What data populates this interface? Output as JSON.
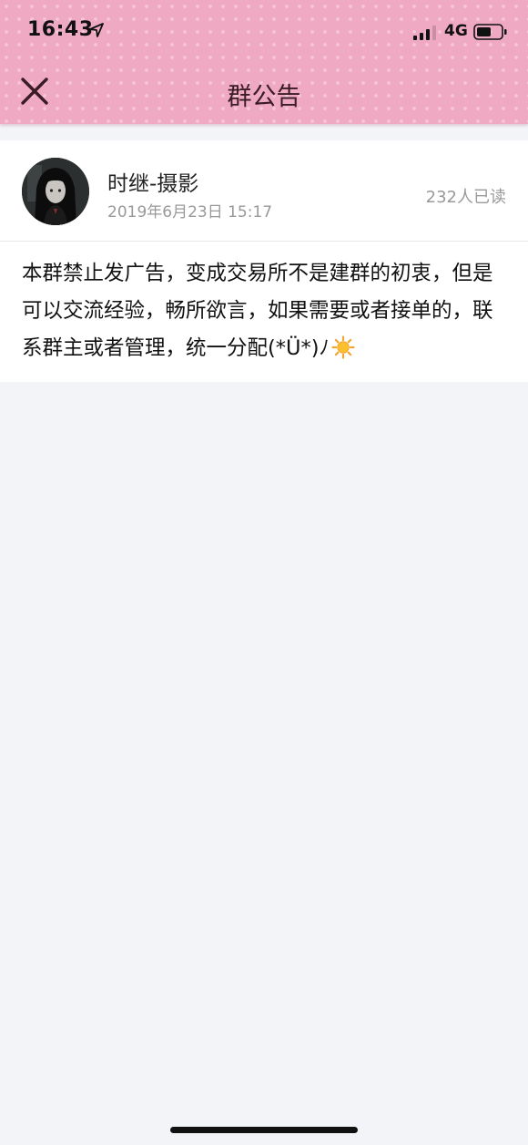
{
  "status_bar": {
    "time": "16:43",
    "network": "4G",
    "icons": [
      "location-arrow-icon",
      "signal-icon",
      "battery-icon"
    ]
  },
  "nav": {
    "title": "群公告",
    "close_icon": "close-icon"
  },
  "announcement": {
    "author": "时继-摄影",
    "timestamp": "2019年6月23日 15:17",
    "read_count": "232人已读",
    "body": "本群禁止发广告，变成交易所不是建群的初衷，但是可以交流经验，畅所欲言，如果需要或者接单的，联系群主或者管理，统一分配(*Ü*)ﾉ",
    "emoji": "sun-icon"
  },
  "colors": {
    "header_pink": "#f0a9c2",
    "title_text": "#3a1c26",
    "page_bg": "#f3f4f8",
    "muted_text": "#999999"
  }
}
